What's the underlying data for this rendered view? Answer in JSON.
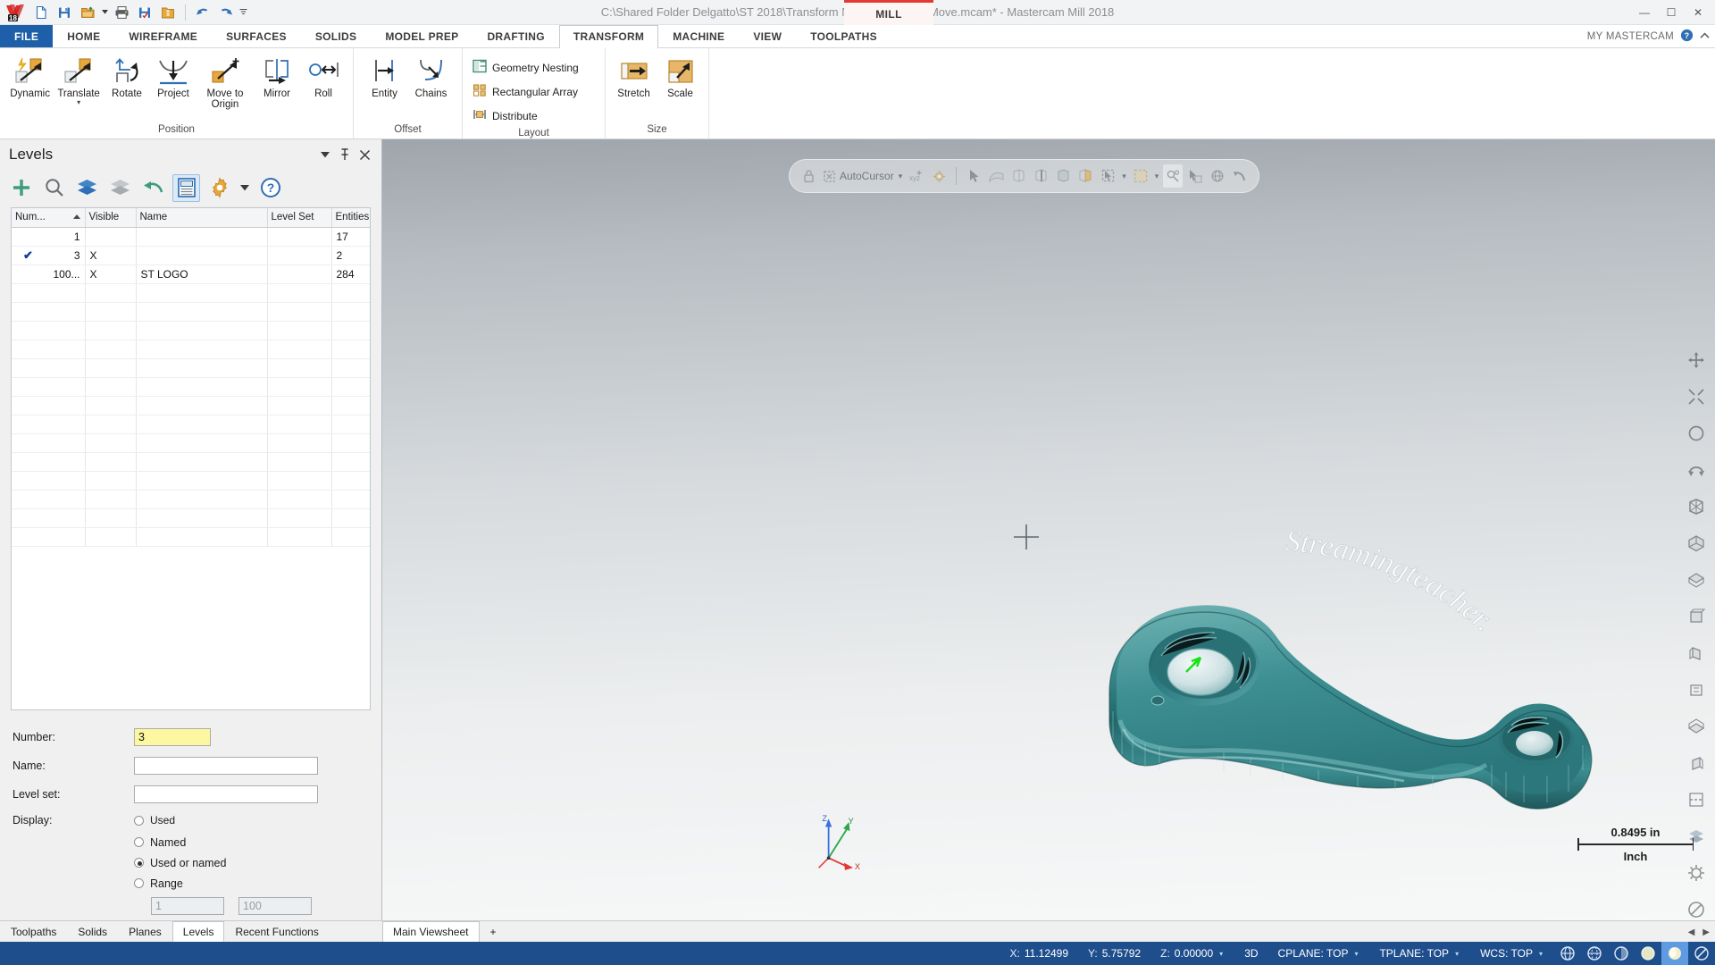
{
  "titlebar": {
    "document_title": "C:\\Shared Folder Delgatto\\ST 2018\\Transform Move\\Transform Move.mcam* - Mastercam Mill 2018",
    "mill_badge": "MILL",
    "quick_access": [
      {
        "name": "new-file-button",
        "icon": "new-file-icon"
      },
      {
        "name": "save-button",
        "icon": "floppy-disk-icon"
      },
      {
        "name": "open-file-button",
        "icon": "open-folder-icon"
      },
      {
        "name": "print-button",
        "icon": "printer-icon"
      },
      {
        "name": "save-as-button",
        "icon": "save-as-icon"
      },
      {
        "name": "folder-properties-button",
        "icon": "folder-info-icon"
      },
      {
        "name": "undo-button",
        "icon": "undo-arrow-icon"
      },
      {
        "name": "redo-button",
        "icon": "redo-arrow-icon"
      }
    ],
    "window_controls": {
      "minimize": "—",
      "maximize": "☐",
      "close": "✕"
    }
  },
  "ribbon": {
    "tabs": [
      {
        "label": "FILE",
        "kind": "file"
      },
      {
        "label": "HOME",
        "kind": "normal"
      },
      {
        "label": "WIREFRAME",
        "kind": "normal"
      },
      {
        "label": "SURFACES",
        "kind": "normal"
      },
      {
        "label": "SOLIDS",
        "kind": "normal"
      },
      {
        "label": "MODEL PREP",
        "kind": "normal"
      },
      {
        "label": "DRAFTING",
        "kind": "normal"
      },
      {
        "label": "TRANSFORM",
        "kind": "active"
      },
      {
        "label": "MACHINE",
        "kind": "normal"
      },
      {
        "label": "VIEW",
        "kind": "normal"
      },
      {
        "label": "TOOLPATHS",
        "kind": "normal"
      }
    ],
    "my_mastercam": "MY MASTERCAM",
    "groups": [
      {
        "label": "Position",
        "buttons": [
          {
            "label": "Dynamic",
            "icon": "dynamic-transform-icon",
            "dropdown": false
          },
          {
            "label": "Translate",
            "icon": "translate-icon",
            "dropdown": true
          },
          {
            "label": "Rotate",
            "icon": "rotate-icon",
            "dropdown": false
          },
          {
            "label": "Project",
            "icon": "project-icon",
            "dropdown": false
          },
          {
            "label": "Move to Origin",
            "icon": "move-to-origin-icon",
            "dropdown": false
          },
          {
            "label": "Mirror",
            "icon": "mirror-icon",
            "dropdown": false
          },
          {
            "label": "Roll",
            "icon": "roll-icon",
            "dropdown": false
          }
        ]
      },
      {
        "label": "Offset",
        "buttons": [
          {
            "label": "Entity",
            "icon": "offset-entity-icon",
            "dropdown": false
          },
          {
            "label": "Chains",
            "icon": "offset-chains-icon",
            "dropdown": false
          }
        ]
      },
      {
        "label": "Layout",
        "small_items": [
          {
            "label": "Geometry Nesting",
            "icon": "geometry-nesting-icon"
          },
          {
            "label": "Rectangular Array",
            "icon": "rectangular-array-icon"
          },
          {
            "label": "Distribute",
            "icon": "distribute-icon"
          }
        ]
      },
      {
        "label": "Size",
        "buttons": [
          {
            "label": "Stretch",
            "icon": "stretch-icon",
            "dropdown": false
          },
          {
            "label": "Scale",
            "icon": "scale-icon",
            "dropdown": false
          }
        ]
      }
    ]
  },
  "levels_panel": {
    "title": "Levels",
    "title_buttons": [
      {
        "name": "panel-menu-button",
        "icon": "chevron-down-icon"
      },
      {
        "name": "panel-pin-button",
        "icon": "pin-icon"
      },
      {
        "name": "panel-close-button",
        "icon": "close-icon"
      }
    ],
    "toolbar": [
      {
        "name": "add-new-level-button",
        "icon": "plus-icon"
      },
      {
        "name": "find-level-button",
        "icon": "search-icon"
      },
      {
        "name": "show-all-levels-button",
        "icon": "layers-blue-icon"
      },
      {
        "name": "hide-all-levels-button",
        "icon": "layers-gray-icon"
      },
      {
        "name": "restore-levels-button",
        "icon": "undo-curve-icon"
      },
      {
        "name": "level-display-options-button",
        "icon": "list-panel-icon"
      },
      {
        "name": "level-settings-button",
        "icon": "gear-icon"
      },
      {
        "name": "settings-dropdown-button",
        "icon": "caret-down-icon"
      },
      {
        "name": "help-button",
        "icon": "question-circle-icon"
      }
    ],
    "grid": {
      "columns": [
        "Num...",
        "Visible",
        "Name",
        "Level Set",
        "Entities"
      ],
      "sorted_column": "Num...",
      "rows": [
        {
          "checked": false,
          "number": "1",
          "visible": "",
          "name": "",
          "level_set": "",
          "entities": "17"
        },
        {
          "checked": true,
          "number": "3",
          "visible": "X",
          "name": "",
          "level_set": "",
          "entities": "2"
        },
        {
          "checked": false,
          "number": "100...",
          "visible": "X",
          "name": "ST LOGO",
          "level_set": "",
          "entities": "284"
        }
      ],
      "empty_row_count": 16
    },
    "form": {
      "number_label": "Number:",
      "number_value": "3",
      "name_label": "Name:",
      "name_value": "",
      "level_set_label": "Level set:",
      "level_set_value": "",
      "display_label": "Display:",
      "display_options": [
        {
          "label": "Used",
          "selected": false
        },
        {
          "label": "Named",
          "selected": false
        },
        {
          "label": "Used or named",
          "selected": true
        },
        {
          "label": "Range",
          "selected": false
        }
      ],
      "range_from": "1",
      "range_to": "100"
    }
  },
  "viewport": {
    "autocursor": {
      "lock_icon": "padlock-icon",
      "label": "AutoCursor",
      "dropdown_icon": "caret-down-icon",
      "xyz_icon": "xyz-point-icon",
      "gear_icon": "autocursor-settings-icon",
      "tools": [
        {
          "name": "select-arrow-tool",
          "icon": "arrow-cursor-icon"
        },
        {
          "name": "select-surface-tool",
          "icon": "select-surface-icon"
        },
        {
          "name": "select-solid-face-tool",
          "icon": "solid-face-icon"
        },
        {
          "name": "select-solid-edge-tool",
          "icon": "solid-edge-icon"
        },
        {
          "name": "select-solid-body-tool",
          "icon": "solid-body-icon"
        },
        {
          "name": "select-partial-tool",
          "icon": "partial-select-icon"
        },
        {
          "name": "select-all-tool",
          "icon": "select-all-icon"
        },
        {
          "name": "select-only-tool",
          "icon": "select-only-icon"
        },
        {
          "name": "analyze-entity-tool",
          "icon": "analyze-icon"
        },
        {
          "name": "dynamic-rotate-tool",
          "icon": "globe-rotate-icon"
        },
        {
          "name": "undo-selection-tool",
          "icon": "undo-select-icon"
        }
      ]
    },
    "right_toolbar": [
      {
        "name": "fit-screen-button",
        "icon": "fit-screen-icon"
      },
      {
        "name": "zoom-window-button",
        "icon": "zoom-window-icon"
      },
      {
        "name": "unzoom-button",
        "icon": "unzoom-icon"
      },
      {
        "name": "dynamic-rotate-button",
        "icon": "dynamic-rotate-icon"
      },
      {
        "name": "wireframe-shade-button",
        "icon": "wireframe-shade-icon"
      },
      {
        "name": "isometric-view-button",
        "icon": "isometric-view-icon"
      },
      {
        "name": "top-view-button",
        "icon": "top-view-icon"
      },
      {
        "name": "front-view-button",
        "icon": "front-view-icon"
      },
      {
        "name": "right-view-button",
        "icon": "right-view-icon"
      },
      {
        "name": "back-view-button",
        "icon": "back-view-icon"
      },
      {
        "name": "bottom-view-button",
        "icon": "bottom-view-icon"
      },
      {
        "name": "left-view-button",
        "icon": "left-view-icon"
      },
      {
        "name": "clipping-plane-button",
        "icon": "clipping-plane-icon"
      },
      {
        "name": "shading-toggle-button",
        "icon": "shading-toggle-icon"
      },
      {
        "name": "viewport-settings-button",
        "icon": "gear-icon"
      },
      {
        "name": "blank-entity-button",
        "icon": "blank-entity-icon"
      }
    ],
    "scale_value": "0.8495 in",
    "scale_unit": "Inch",
    "axes": {
      "x": "X",
      "y": "Y",
      "z": "Z"
    },
    "watermark": "Streamingteacher.",
    "part_color": "#2d7e82"
  },
  "bottom_tabs": {
    "tabs": [
      {
        "label": "Toolpaths",
        "active": false
      },
      {
        "label": "Solids",
        "active": false
      },
      {
        "label": "Planes",
        "active": false
      },
      {
        "label": "Levels",
        "active": true
      },
      {
        "label": "Recent Functions",
        "active": false
      }
    ],
    "viewsheets": [
      {
        "label": "Main Viewsheet",
        "active": true
      },
      {
        "label": "+",
        "active": false
      }
    ],
    "nav": {
      "prev": "◀",
      "next": "▶"
    }
  },
  "statusbar": {
    "coords": [
      {
        "key": "X:",
        "value": "11.12499",
        "caret": false
      },
      {
        "key": "Y:",
        "value": "5.75792",
        "caret": false
      },
      {
        "key": "Z:",
        "value": "0.00000",
        "caret": true
      }
    ],
    "mode": "3D",
    "planes": [
      {
        "label": "CPLANE: TOP",
        "caret": true
      },
      {
        "label": "TPLANE: TOP",
        "caret": true
      },
      {
        "label": "WCS: TOP",
        "caret": true
      }
    ],
    "icons": [
      {
        "name": "gnomon-wireframe-button",
        "icon": "sphere-wire-icon",
        "active": false
      },
      {
        "name": "gnomon-hidden-button",
        "icon": "sphere-hidden-icon",
        "active": false
      },
      {
        "name": "gnomon-shaded-button",
        "icon": "sphere-half-icon",
        "active": false
      },
      {
        "name": "shade-off-button",
        "icon": "shade-off-icon",
        "active": false
      },
      {
        "name": "shade-on-button",
        "icon": "shade-on-icon",
        "active": true
      },
      {
        "name": "translucent-button",
        "icon": "translucent-icon",
        "active": false
      }
    ],
    "accent_color": "#1f4e8c"
  }
}
